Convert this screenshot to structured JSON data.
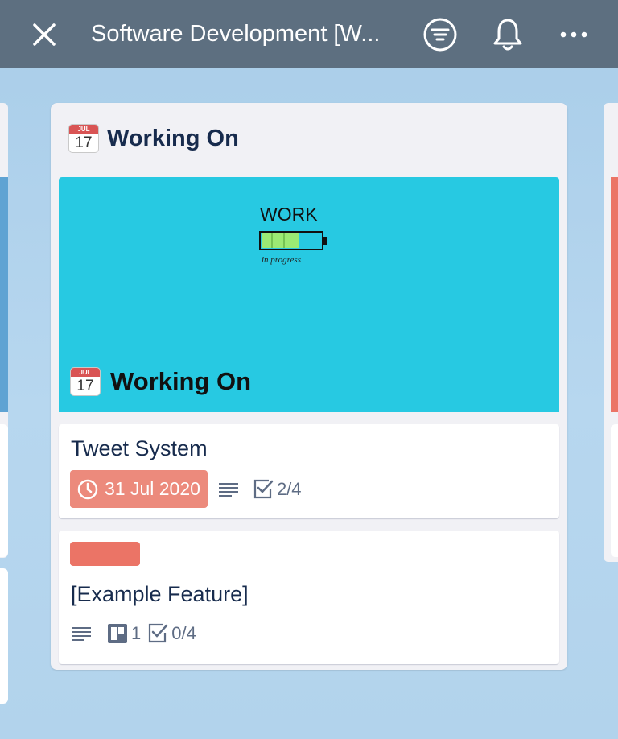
{
  "header": {
    "title": "Software Development [W...",
    "close_icon": "close-icon",
    "filter_icon": "filter-icon",
    "notifications_icon": "bell-icon",
    "more_icon": "more-icon"
  },
  "list": {
    "title": "Working On",
    "icon": {
      "month": "JUL",
      "day": "17"
    },
    "cover": {
      "title": "Working On",
      "art": {
        "word": "WORK",
        "caption": "in progress"
      }
    },
    "cards": [
      {
        "title": "Tweet System",
        "due_date": "31 Jul 2020",
        "due_color": "#ec8a7c",
        "has_description": true,
        "checklist": "2/4"
      },
      {
        "label_color": "#eb7466",
        "title": "[Example Feature]",
        "has_description": true,
        "attachments": "1",
        "checklist": "0/4"
      }
    ]
  },
  "colors": {
    "header_bg": "#5d6f80",
    "cover_bg": "#27c9e2",
    "left_list_accent": "#5fa3d3",
    "right_list_accent": "#eb7466"
  }
}
